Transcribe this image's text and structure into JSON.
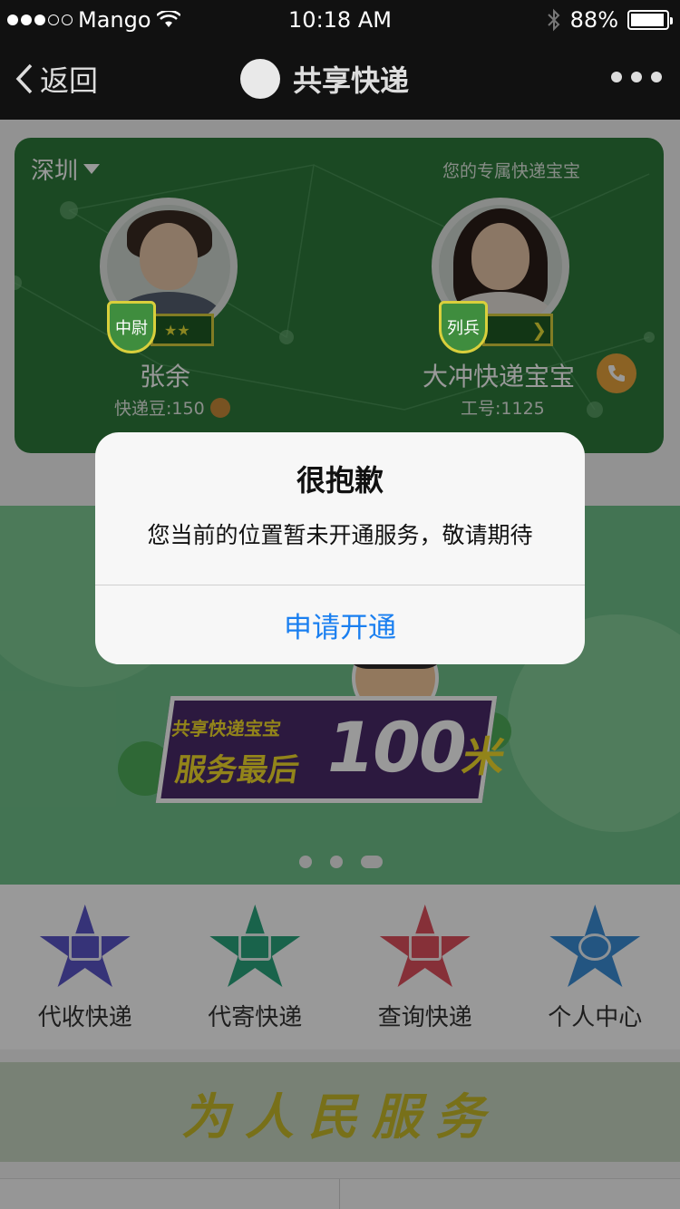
{
  "status_bar": {
    "carrier": "Mango",
    "time": "10:18 AM",
    "battery": "88%",
    "battery_level": 0.88,
    "signal_bars_filled": 3,
    "signal_bars_total": 5
  },
  "nav": {
    "back_label": "返回",
    "title": "共享快递"
  },
  "courier_card": {
    "city": "深圳",
    "exclusive_label": "您的专属快递宝宝",
    "user": {
      "rank": "中尉",
      "stars": "★★",
      "name": "张余",
      "beans": "快递豆:150"
    },
    "courier": {
      "rank": "列兵",
      "name": "大冲快递宝宝",
      "employee_id": "工号:1125"
    }
  },
  "banner": {
    "subtitle": "共享快递宝宝",
    "main_text": "服务最后",
    "number": "100",
    "unit": "米",
    "slides_total": 3,
    "active_slide": 3
  },
  "quick_menu": [
    {
      "label": "代收快递",
      "icon": "package-icon",
      "color": "#5a55c8"
    },
    {
      "label": "代寄快递",
      "icon": "delivery-truck-icon",
      "color": "#2aa67e"
    },
    {
      "label": "查询快递",
      "icon": "search-document-icon",
      "color": "#e0505e"
    },
    {
      "label": "个人中心",
      "icon": "person-icon",
      "color": "#3b8ed8"
    }
  ],
  "slogan": "为人民服务",
  "alert": {
    "title": "很抱歉",
    "message": "您当前的位置暂未开通服务，敬请期待",
    "button_label": "申请开通"
  },
  "colors": {
    "accent": "#1a7ff0",
    "card_green": "#2e7a3b",
    "rank_gold": "#d9cf3c",
    "phone_orange": "#e8a33c"
  }
}
